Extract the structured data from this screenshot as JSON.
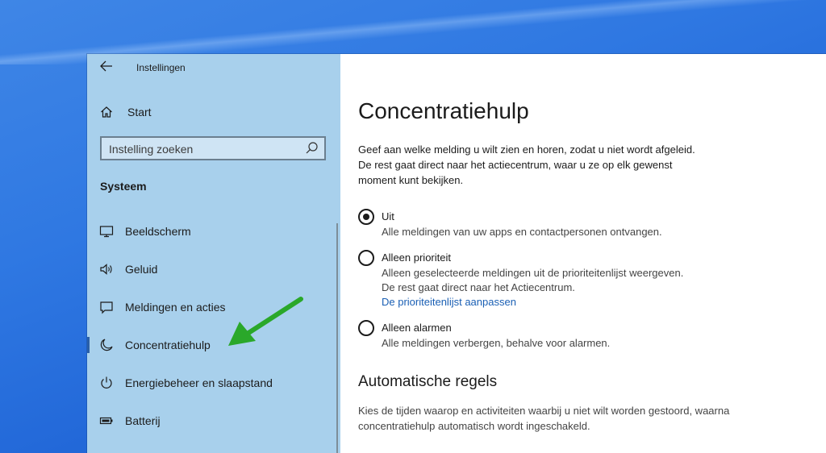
{
  "window": {
    "app_title": "Instellingen",
    "back_icon": "back-arrow-icon"
  },
  "sidebar": {
    "home_label": "Start",
    "search_placeholder": "Instelling zoeken",
    "section_title": "Systeem",
    "items": [
      {
        "label": "Beeldscherm",
        "icon": "monitor-icon"
      },
      {
        "label": "Geluid",
        "icon": "speaker-icon"
      },
      {
        "label": "Meldingen en acties",
        "icon": "notification-icon"
      },
      {
        "label": "Concentratiehulp",
        "icon": "moon-icon",
        "active": true
      },
      {
        "label": "Energiebeheer en slaapstand",
        "icon": "power-icon"
      },
      {
        "label": "Batterij",
        "icon": "battery-icon"
      }
    ]
  },
  "main": {
    "title": "Concentratiehulp",
    "description": "Geef aan welke melding u wilt zien en horen, zodat u niet wordt afgeleid. De rest gaat direct naar het actiecentrum, waar u ze op elk gewenst moment kunt bekijken.",
    "options": [
      {
        "title": "Uit",
        "desc": "Alle meldingen van uw apps en contactpersonen ontvangen.",
        "checked": true
      },
      {
        "title": "Alleen prioriteit",
        "desc_line1": "Alleen geselecteerde meldingen uit de prioriteitenlijst weergeven.",
        "desc_line2": "De rest gaat direct naar het Actiecentrum.",
        "link": "De prioriteitenlijst aanpassen",
        "checked": false
      },
      {
        "title": "Alleen alarmen",
        "desc": "Alle meldingen verbergen, behalve voor alarmen.",
        "checked": false
      }
    ],
    "auto_rules_title": "Automatische regels",
    "auto_rules_desc": "Kies de tijden waarop en activiteiten waarbij u niet wilt worden gestoord, waarna concentratiehulp automatisch wordt ingeschakeld."
  },
  "colors": {
    "sidebar_bg": "#a8d0ec",
    "accent_link": "#1a5fb4",
    "annotation_arrow": "#2aa82a"
  }
}
